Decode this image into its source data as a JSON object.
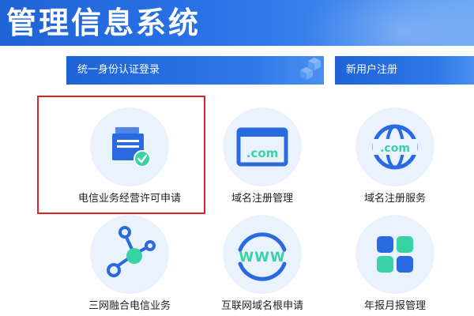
{
  "header": {
    "title": "管理信息系统"
  },
  "sections": {
    "login_label": "统一身份认证登录",
    "register_label": "新用户注册"
  },
  "tiles": [
    {
      "label": "电信业务经营许可申请",
      "icon": "license-application-icon"
    },
    {
      "label": "域名注册管理",
      "icon": "dotcom-window-icon",
      "icon_text": ".com"
    },
    {
      "label": "域名注册服务",
      "icon": "dotcom-globe-icon",
      "icon_text": ".com"
    },
    {
      "label": "三网融合电信业务",
      "icon": "network-nodes-icon"
    },
    {
      "label": "互联网域名根申请",
      "icon": "www-icon",
      "icon_text": "WWW"
    },
    {
      "label": "年报月报管理",
      "icon": "report-grid-icon"
    }
  ],
  "colors": {
    "brand_blue": "#1f63d6",
    "icon_blue": "#2a6ae0",
    "icon_green": "#37d3a4",
    "highlight_red": "#d9232d"
  }
}
